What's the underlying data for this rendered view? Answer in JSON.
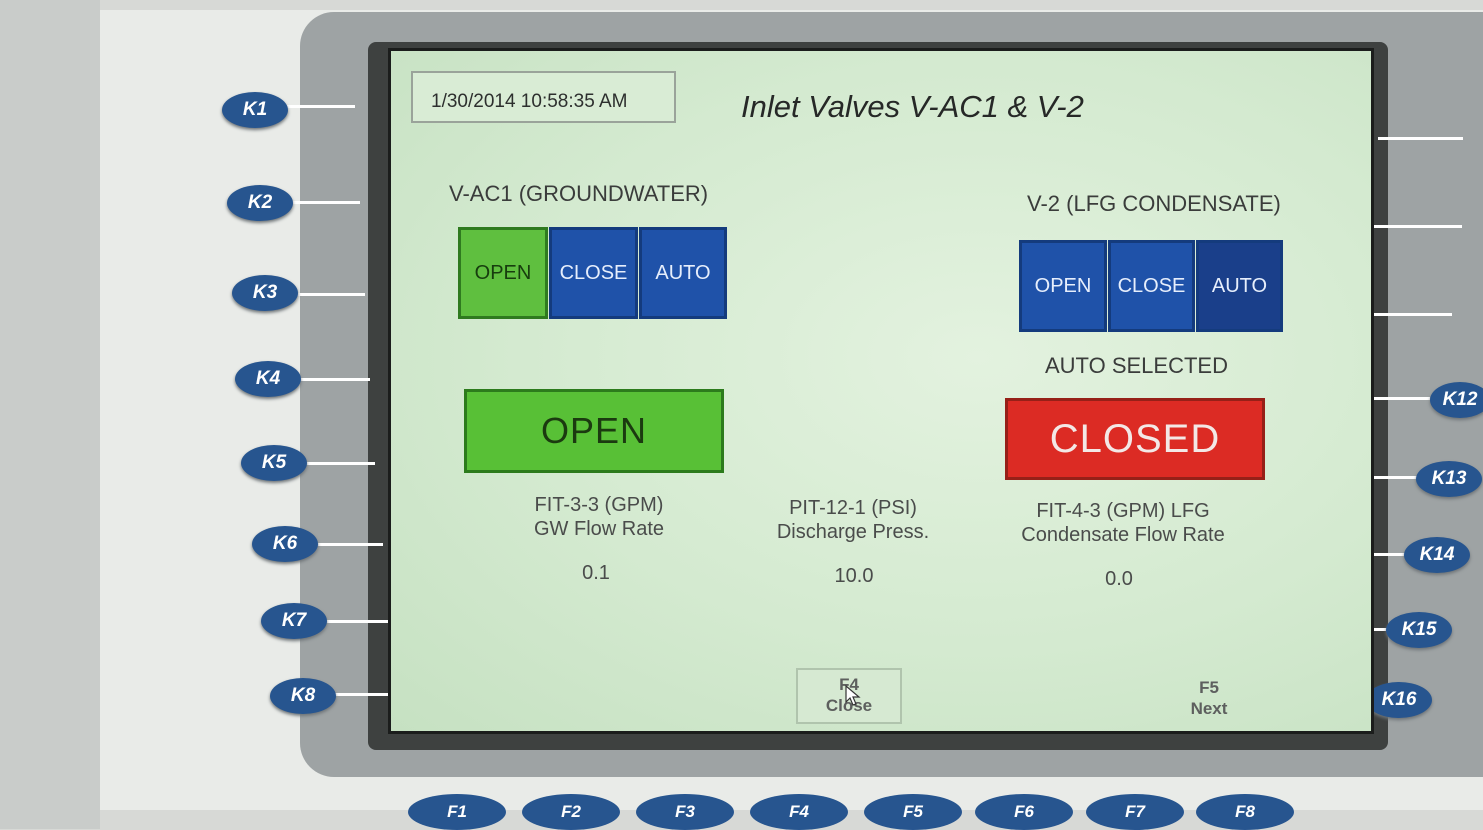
{
  "hmi": {
    "datetime": "1/30/2014 10:58:35 AM",
    "title": "Inlet Valves V-AC1 & V-2",
    "vac1": {
      "label": "V-AC1 (GROUNDWATER)",
      "buttons": {
        "open": "OPEN",
        "close": "CLOSE",
        "auto": "AUTO"
      },
      "active_button": "OPEN",
      "status": "OPEN",
      "status_color": "#58c036"
    },
    "v2": {
      "label": "V-2 (LFG CONDENSATE)",
      "buttons": {
        "open": "OPEN",
        "close": "CLOSE",
        "auto": "AUTO"
      },
      "mode_text": "AUTO SELECTED",
      "status": "CLOSED",
      "status_color": "#dc2b24"
    },
    "measurements": [
      {
        "tag": "FIT-3-3 (GPM)",
        "desc": "GW Flow Rate",
        "value": "0.1"
      },
      {
        "tag": "PIT-12-1 (PSI)",
        "desc": "Discharge Press.",
        "value": "10.0"
      },
      {
        "tag": "FIT-4-3 (GPM) LFG",
        "desc": "Condensate Flow Rate",
        "value": "0.0"
      }
    ],
    "function_buttons": [
      {
        "key": "F4",
        "label": "Close"
      },
      {
        "key": "F5",
        "label": "Next"
      }
    ]
  },
  "bezel": {
    "left_keys": [
      "K1",
      "K2",
      "K3",
      "K4",
      "K5",
      "K6",
      "K7",
      "K8"
    ],
    "right_keys": [
      "K12",
      "K13",
      "K14",
      "K15",
      "K16"
    ],
    "bottom_keys": [
      "F1",
      "F2",
      "F3",
      "F4",
      "F5",
      "F6",
      "F7",
      "F8"
    ],
    "key_color": "#27558f"
  }
}
